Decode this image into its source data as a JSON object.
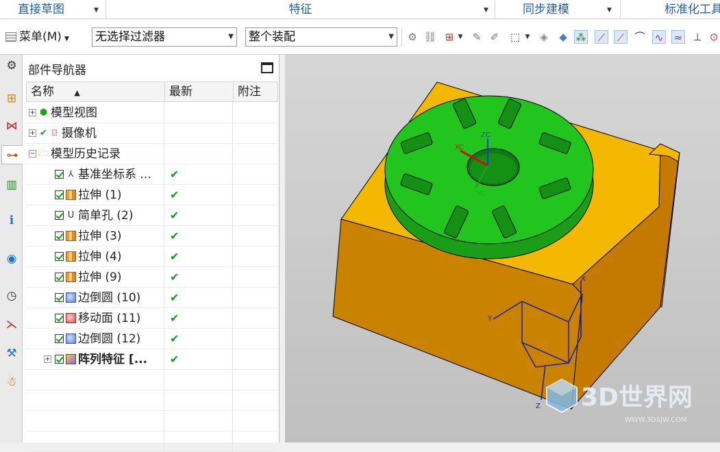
{
  "ribbon": {
    "groups": [
      {
        "label": "直接草图"
      },
      {
        "label": "特征"
      },
      {
        "label": "同步建模"
      },
      {
        "label": "标准化工具"
      }
    ]
  },
  "toolbar": {
    "menu_label": "菜单(M)",
    "filter_value": "无选择过滤器",
    "scope_value": "整个装配"
  },
  "navigator": {
    "title": "部件导航器",
    "columns": [
      "名称",
      "最新",
      "附注"
    ],
    "rows": [
      {
        "label": "模型视图",
        "latest": ""
      },
      {
        "label": "摄像机",
        "latest": ""
      },
      {
        "label": "模型历史记录",
        "latest": ""
      },
      {
        "label": "基准坐标系 ...",
        "latest": "✔"
      },
      {
        "label": "拉伸 (1)",
        "latest": "✔"
      },
      {
        "label": "简单孔 (2)",
        "latest": "✔"
      },
      {
        "label": "拉伸 (3)",
        "latest": "✔"
      },
      {
        "label": "拉伸 (4)",
        "latest": "✔"
      },
      {
        "label": "拉伸 (9)",
        "latest": "✔"
      },
      {
        "label": "边倒圆 (10)",
        "latest": "✔"
      },
      {
        "label": "移动面 (11)",
        "latest": "✔"
      },
      {
        "label": "边倒圆 (12)",
        "latest": "✔"
      },
      {
        "label": "阵列特征 [...",
        "latest": "✔"
      }
    ]
  },
  "viewport": {
    "axis_labels": {
      "xc": "XC",
      "zc": "ZC",
      "yc": "YC",
      "x": "X",
      "y": "Y",
      "z": "Z"
    },
    "colors": {
      "part_green": "#22c41e",
      "part_gold": "#f5b800",
      "part_bronze": "#c47a00",
      "background": "#cfcfcf"
    }
  },
  "watermark": {
    "brand": "3D世界网",
    "url": "WWW.3DSJW.COM"
  }
}
